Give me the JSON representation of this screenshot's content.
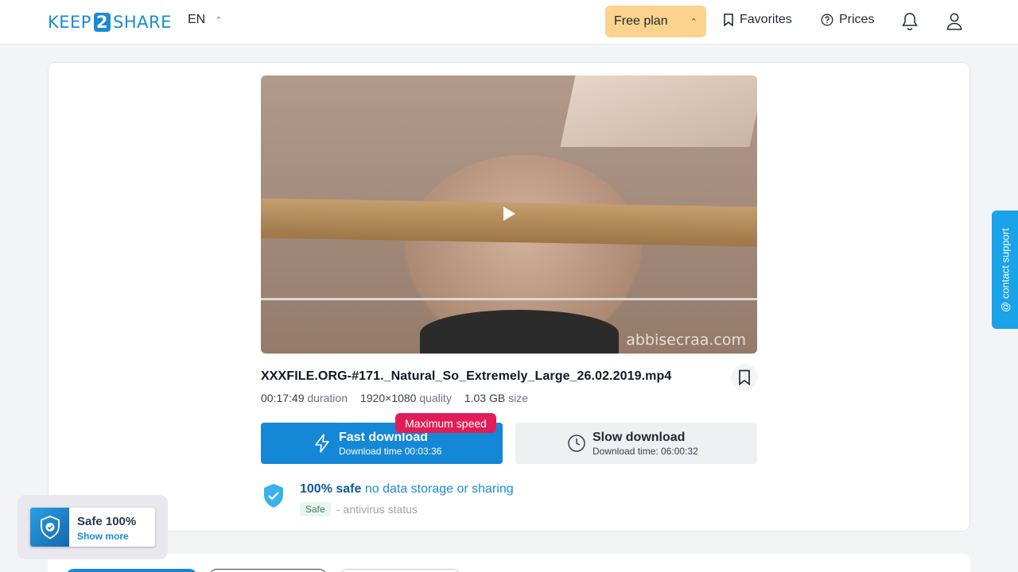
{
  "header": {
    "logo_left": "KEEP",
    "logo_mid": "2",
    "logo_right": "SHARE",
    "language": "EN",
    "plan_label": "Free plan",
    "favorites_label": "Favorites",
    "prices_label": "Prices"
  },
  "video": {
    "watermark": "abbisecraa.com"
  },
  "file": {
    "name": "XXXFILE.ORG-#171._Natural_So_Extremely_Large_26.02.2019.mp4",
    "duration_value": "00:17:49",
    "duration_label": "duration",
    "quality_value": "1920×1080",
    "quality_label": "quality",
    "size_value": "1.03 GB",
    "size_label": "size"
  },
  "download": {
    "fast_title": "Fast download",
    "fast_time": "Download time 00:03:36",
    "badge": "Maximum speed",
    "slow_title": "Slow download",
    "slow_time": "Download time: 06:00:32"
  },
  "safety": {
    "strong": "100% safe",
    "rest": "no data storage or sharing",
    "badge": "Safe",
    "antivirus": "- antivirus status"
  },
  "contact_label": "@ contact support",
  "safe_widget": {
    "title": "Safe 100%",
    "link": "Show more"
  },
  "colors": {
    "primary": "#1487d6",
    "plan_bg": "#fbd38d",
    "badge_red": "#e11d59",
    "support": "#1aa3e8"
  }
}
